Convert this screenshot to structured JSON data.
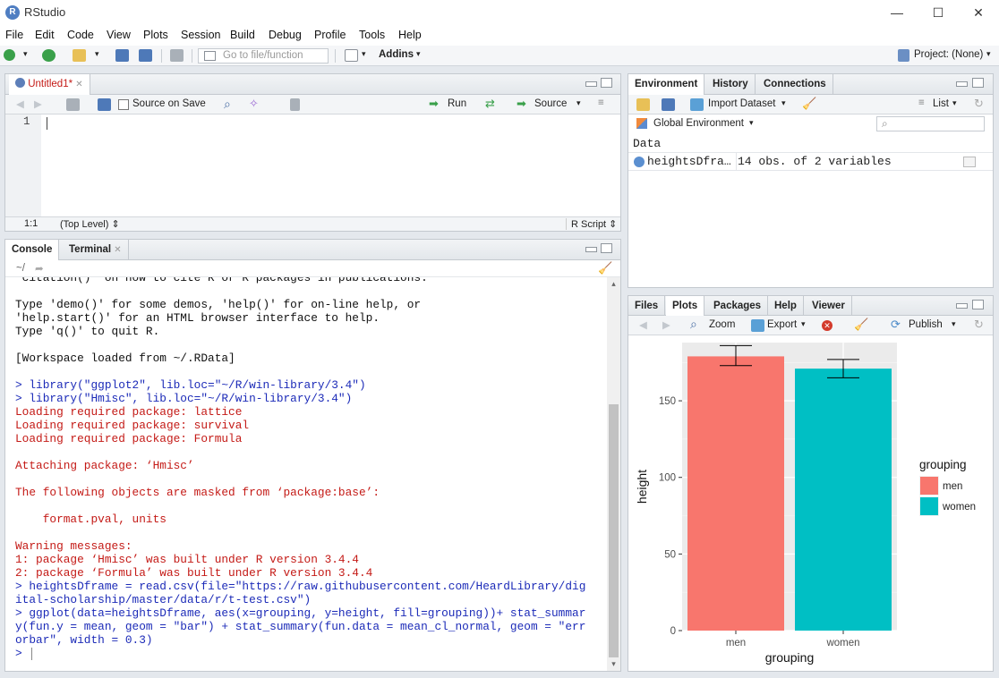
{
  "window": {
    "title": "RStudio",
    "minimize": "—",
    "maximize": "☐",
    "close": "✕"
  },
  "menu": [
    "File",
    "Edit",
    "Code",
    "View",
    "Plots",
    "Session",
    "Build",
    "Debug",
    "Profile",
    "Tools",
    "Help"
  ],
  "toolbar": {
    "goto_placeholder": "Go to file/function",
    "addins": "Addins",
    "project": "Project: (None)"
  },
  "editor": {
    "tab": "Untitled1*",
    "source_on_save": "Source on Save",
    "run": "Run",
    "source": "Source",
    "line_number": "1",
    "status_pos": "1:1",
    "status_level": "(Top Level)",
    "status_type": "R Script"
  },
  "console": {
    "tabs": [
      "Console",
      "Terminal"
    ],
    "path": "~/",
    "lines": [
      {
        "text": "'citation()' on how to cite R or R packages in publications.",
        "color": "dark"
      },
      {
        "text": "",
        "color": "dark"
      },
      {
        "text": "Type 'demo()' for some demos, 'help()' for on-line help, or",
        "color": "dark"
      },
      {
        "text": "'help.start()' for an HTML browser interface to help.",
        "color": "dark"
      },
      {
        "text": "Type 'q()' to quit R.",
        "color": "dark"
      },
      {
        "text": "",
        "color": "dark"
      },
      {
        "text": "[Workspace loaded from ~/.RData]",
        "color": "dark"
      },
      {
        "text": "",
        "color": "dark"
      },
      {
        "text": "> library(\"ggplot2\", lib.loc=\"~/R/win-library/3.4\")",
        "color": "blue"
      },
      {
        "text": "> library(\"Hmisc\", lib.loc=\"~/R/win-library/3.4\")",
        "color": "blue"
      },
      {
        "text": "Loading required package: lattice",
        "color": "red"
      },
      {
        "text": "Loading required package: survival",
        "color": "red"
      },
      {
        "text": "Loading required package: Formula",
        "color": "red"
      },
      {
        "text": "",
        "color": "dark"
      },
      {
        "text": "Attaching package: ‘Hmisc’",
        "color": "red"
      },
      {
        "text": "",
        "color": "dark"
      },
      {
        "text": "The following objects are masked from ‘package:base’:",
        "color": "red"
      },
      {
        "text": "",
        "color": "dark"
      },
      {
        "text": "    format.pval, units",
        "color": "red"
      },
      {
        "text": "",
        "color": "dark"
      },
      {
        "text": "Warning messages:",
        "color": "red"
      },
      {
        "text": "1: package ‘Hmisc’ was built under R version 3.4.4",
        "color": "red"
      },
      {
        "text": "2: package ‘Formula’ was built under R version 3.4.4",
        "color": "red"
      },
      {
        "text": "> heightsDframe = read.csv(file=\"https://raw.githubusercontent.com/HeardLibrary/dig",
        "color": "blue"
      },
      {
        "text": "ital-scholarship/master/data/r/t-test.csv\")",
        "color": "blue"
      },
      {
        "text": "> ggplot(data=heightsDframe, aes(x=grouping, y=height, fill=grouping))+ stat_summar",
        "color": "blue"
      },
      {
        "text": "y(fun.y = mean, geom = \"bar\") + stat_summary(fun.data = mean_cl_normal, geom = \"err",
        "color": "blue"
      },
      {
        "text": "orbar\", width = 0.3)",
        "color": "blue"
      },
      {
        "text": "> ",
        "color": "blue"
      }
    ]
  },
  "environment": {
    "tabs": [
      "Environment",
      "History",
      "Connections"
    ],
    "import_dataset": "Import Dataset",
    "view_mode": "List",
    "scope": "Global Environment",
    "section": "Data",
    "rows": [
      {
        "name": "heightsDfra…",
        "value": "14 obs. of 2 variables"
      }
    ]
  },
  "files": {
    "tabs": [
      "Files",
      "Plots",
      "Packages",
      "Help",
      "Viewer"
    ],
    "zoom": "Zoom",
    "export": "Export",
    "publish": "Publish"
  },
  "chart_data": {
    "type": "bar",
    "categories": [
      "men",
      "women"
    ],
    "values": [
      179,
      171
    ],
    "error_low": [
      173,
      165
    ],
    "error_high": [
      186,
      177
    ],
    "colors": [
      "#f8766d",
      "#00bfc4"
    ],
    "xlabel": "grouping",
    "ylabel": "height",
    "yticks": [
      0,
      50,
      100,
      150
    ],
    "ylim": [
      0,
      188
    ],
    "legend": {
      "title": "grouping",
      "entries": [
        "men",
        "women"
      ],
      "position": "right"
    }
  }
}
